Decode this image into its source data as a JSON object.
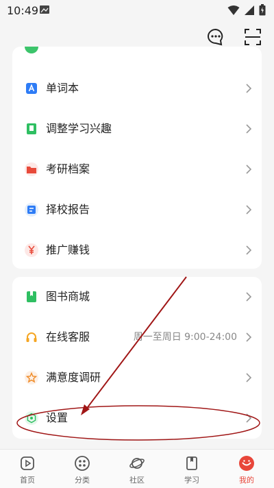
{
  "status_bar": {
    "time": "10:49"
  },
  "menu_group_1": {
    "items": [
      {
        "label": "单词本",
        "icon": "word-book-icon"
      },
      {
        "label": "调整学习兴趣",
        "icon": "interest-book-icon"
      },
      {
        "label": "考研档案",
        "icon": "folder-icon"
      },
      {
        "label": "择校报告",
        "icon": "report-icon"
      },
      {
        "label": "推广赚钱",
        "icon": "yuan-icon"
      }
    ]
  },
  "menu_group_2": {
    "items": [
      {
        "label": "图书商城",
        "icon": "book-store-icon"
      },
      {
        "label": "在线客服",
        "extra": "周一至周日 9:00-24:00",
        "icon": "headset-icon"
      },
      {
        "label": "满意度调研",
        "icon": "star-icon"
      },
      {
        "label": "设置",
        "icon": "settings-icon"
      }
    ]
  },
  "bottom_nav": {
    "items": [
      {
        "label": "首页"
      },
      {
        "label": "分类"
      },
      {
        "label": "社区"
      },
      {
        "label": "学习"
      },
      {
        "label": "我的"
      }
    ],
    "active": "我的"
  },
  "colors": {
    "accent": "#e8463a",
    "annotation": "#a01616"
  }
}
